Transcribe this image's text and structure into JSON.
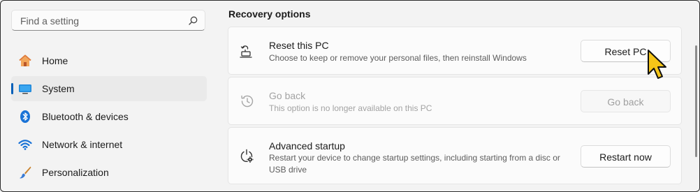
{
  "search": {
    "placeholder": "Find a setting",
    "icon": "search-icon"
  },
  "sidebar": {
    "items": [
      {
        "label": "Home",
        "icon": "home-icon",
        "active": false
      },
      {
        "label": "System",
        "icon": "system-monitor-icon",
        "active": true
      },
      {
        "label": "Bluetooth & devices",
        "icon": "bluetooth-icon",
        "active": false
      },
      {
        "label": "Network & internet",
        "icon": "wifi-icon",
        "active": false
      },
      {
        "label": "Personalization",
        "icon": "paintbrush-icon",
        "active": false
      }
    ]
  },
  "main": {
    "section_title": "Recovery options",
    "options": [
      {
        "title": "Reset this PC",
        "description": "Choose to keep or remove your personal files, then reinstall Windows",
        "button": "Reset PC",
        "icon": "reset-pc-icon",
        "enabled": true
      },
      {
        "title": "Go back",
        "description": "This option is no longer available on this PC",
        "button": "Go back",
        "icon": "history-icon",
        "enabled": false
      },
      {
        "title": "Advanced startup",
        "description": "Restart your device to change startup settings, including starting from a disc or USB drive",
        "button": "Restart now",
        "icon": "advanced-startup-icon",
        "enabled": true
      }
    ]
  },
  "colors": {
    "accent": "#005fb8",
    "background": "#f3f3f3",
    "card": "#fbfbfb",
    "cursor": "#f5c518"
  }
}
